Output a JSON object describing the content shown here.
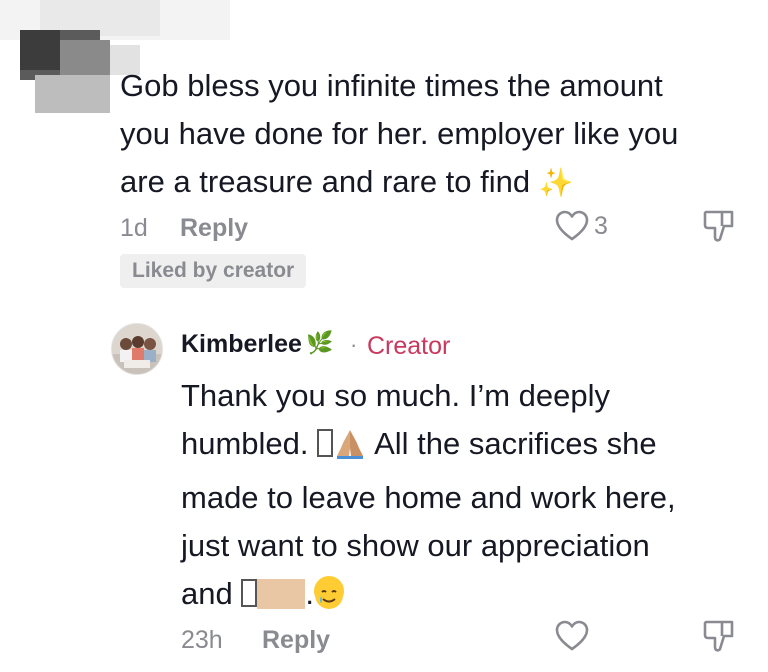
{
  "comment": {
    "text_line1": "Gob bless you infinite times the amount",
    "text_line2": "you have done for her. employer like you",
    "text_line3": "are a treasure and rare to find",
    "emoji": "sparkles",
    "time": "1d",
    "reply_label": "Reply",
    "like_count": "3",
    "liked_badge": "Liked by creator"
  },
  "reply": {
    "author": "Kimberlee",
    "author_emoji": "herb",
    "separator": "·",
    "role": "Creator",
    "line1": "Thank you so much. I’m deeply",
    "line2_start": "humbled.",
    "line2_end": "All the sacrifices she",
    "line3": "made to leave home and work here,",
    "line4": "just want to show our appreciation",
    "line5_start": "and",
    "line5_dot": ".",
    "time": "23h",
    "reply_label": "Reply"
  },
  "colors": {
    "text": "#161823",
    "muted": "#8a8b91",
    "creator": "#c9385e",
    "badge_bg": "#efefef"
  }
}
